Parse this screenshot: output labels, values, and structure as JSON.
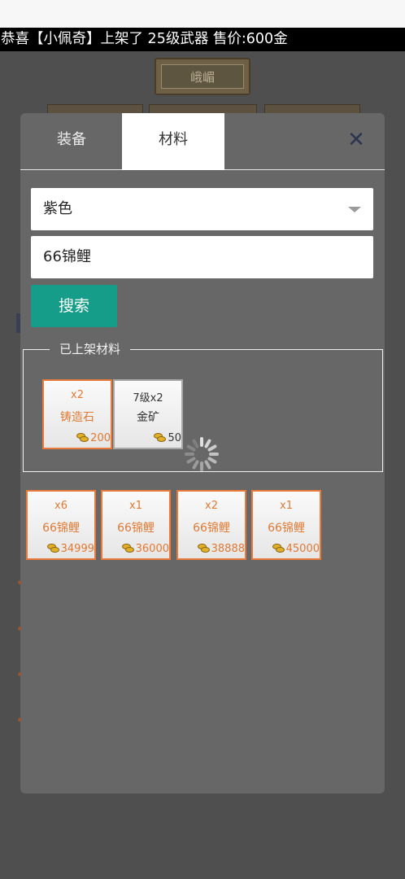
{
  "ticker": {
    "text": "恭喜【小佩奇】上架了 25级武器 售价:600金"
  },
  "background": {
    "sign_text": "峨嵋"
  },
  "dialog": {
    "tabs": [
      {
        "label": "装备",
        "active": false
      },
      {
        "label": "材料",
        "active": true
      }
    ],
    "close_icon": "close-icon"
  },
  "filter": {
    "quality_selected": "紫色",
    "search_value": "66锦鲤",
    "search_button": "搜索"
  },
  "listed": {
    "title": "已上架材料",
    "items": [
      {
        "qty": "x2",
        "name": "铸造石",
        "price": "200"
      },
      {
        "qty": "7级x2",
        "name": "金矿",
        "price": "50"
      }
    ]
  },
  "results": [
    {
      "qty": "x6",
      "name": "66锦鲤",
      "price": "34999"
    },
    {
      "qty": "x1",
      "name": "66锦鲤",
      "price": "36000"
    },
    {
      "qty": "x2",
      "name": "66锦鲤",
      "price": "38888"
    },
    {
      "qty": "x1",
      "name": "66锦鲤",
      "price": "45000"
    }
  ],
  "colors": {
    "accent_orange": "#ea7a3c",
    "search_green": "#159d89",
    "dialog_bg": "#676767"
  }
}
